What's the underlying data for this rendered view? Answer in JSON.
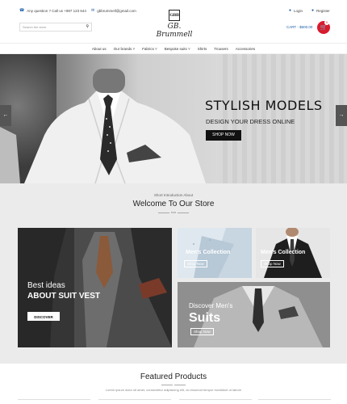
{
  "topbar": {
    "question": "Any question ? Call us +987 123 644",
    "email": "gbbrummell@gmail.com",
    "login": "Login",
    "register": "Register"
  },
  "logo": {
    "mark": "GBB",
    "text": "GB. Brummell"
  },
  "search": {
    "placeholder": "Search the store"
  },
  "cart": {
    "label": "CART - $600.00",
    "count": "0"
  },
  "nav": {
    "items": [
      "About us",
      "Our brands",
      "Fabrics",
      "Bespoke suits",
      "Shirts",
      "Trousers",
      "Accessories"
    ]
  },
  "hero": {
    "title": "STYLISH MODELS",
    "subtitle": "DESIGN YOUR DRESS ONLINE",
    "button": "SHOP NOW",
    "prev": "←",
    "next": "→"
  },
  "intro": {
    "small": "Short Introduction About",
    "title": "Welcome To Our Store",
    "divider": "BGB"
  },
  "banners": {
    "vest": {
      "line1": "Best ideas",
      "line2": "ABOUT SUIT VEST",
      "button": "DISCOVER"
    },
    "collection1": {
      "title": "Men's Collection",
      "button": "Shop Now"
    },
    "collection2": {
      "title": "Men's Collection",
      "button": "Shop Now"
    },
    "suits": {
      "line1": "Discover Men's",
      "line2": "Suits",
      "button": "Shop Now"
    }
  },
  "featured": {
    "title": "Featured Products",
    "subtitle": "Lorem ipsum dolor sit amet, consectetur adipisicing elit, do eiusmod tempor incididunt ut labore"
  },
  "colors": {
    "accent": "#1a5fa8",
    "cart": "#d81b2d",
    "dark": "#111111"
  }
}
